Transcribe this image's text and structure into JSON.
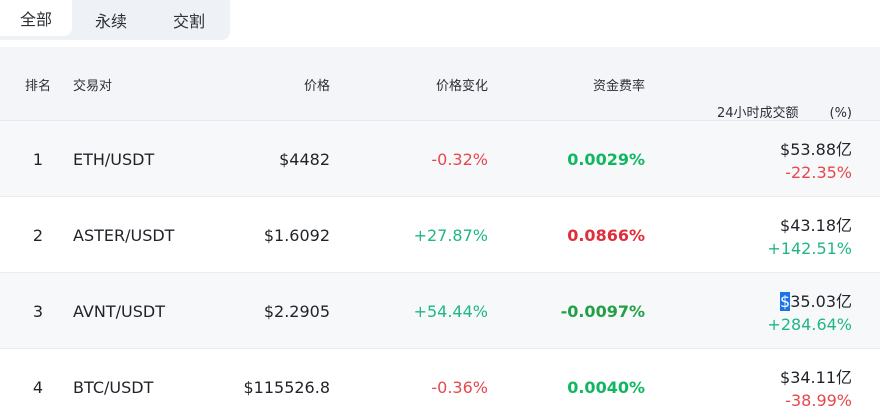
{
  "tabs": [
    {
      "label": "全部",
      "active": true
    },
    {
      "label": "永续",
      "active": false
    },
    {
      "label": "交割",
      "active": false
    }
  ],
  "headers": {
    "rank": "排名",
    "pair": "交易对",
    "price": "价格",
    "change": "价格变化",
    "funding": "资金费率",
    "volume": "24小时成交额",
    "volume_pct": "(%)"
  },
  "rows": [
    {
      "rank": "1",
      "pair": "ETH/USDT",
      "price": "$4482",
      "change": "-0.32%",
      "funding": "0.0029%",
      "volume_symbol": "$",
      "volume_value": "53.88亿",
      "volume_change": "-22.35%"
    },
    {
      "rank": "2",
      "pair": "ASTER/USDT",
      "price": "$1.6092",
      "change": "+27.87%",
      "funding": "0.0866%",
      "volume_symbol": "$",
      "volume_value": "43.18亿",
      "volume_change": "+142.51%"
    },
    {
      "rank": "3",
      "pair": "AVNT/USDT",
      "price": "$2.2905",
      "change": "+54.44%",
      "funding": "-0.0097%",
      "volume_symbol": "$",
      "volume_value": "35.03亿",
      "volume_change": "+284.64%"
    },
    {
      "rank": "4",
      "pair": "BTC/USDT",
      "price": "$115526.8",
      "change": "-0.36%",
      "funding": "0.0040%",
      "volume_symbol": "$",
      "volume_value": "34.11亿",
      "volume_change": "-38.99%"
    }
  ],
  "colors": {
    "negative": "#e5484d",
    "positive": "#1fb784",
    "funding_positive": "#10b760",
    "funding_high": "#e02e3a",
    "funding_negative": "#23a047",
    "selection": "#1a73e8"
  }
}
